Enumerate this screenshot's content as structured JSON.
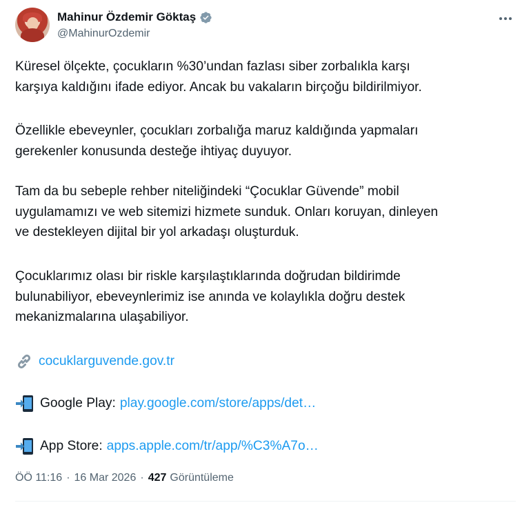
{
  "author": {
    "display_name": "Mahinur Özdemir Göktaş",
    "handle": "@MahinurOzdemir",
    "verified": true,
    "verified_color": "#829aab",
    "avatar": "avatar-photo"
  },
  "more_icon": "more-dots-icon",
  "tweet": {
    "paragraphs": [
      {
        "lines": [
          "Küresel ölçekte, çocukların %30’undan fazlası siber zorbalıkla karşı",
          "karşıya kaldığını ifade ediyor. Ancak bu vakaların birçoğu bildirilmiyor."
        ]
      },
      {
        "lines": [
          "Özellikle ebeveynler, çocukları zorbalığa maruz kaldığında yapmaları",
          "gerekenler konusunda desteğe ihtiyaç duyuyor."
        ]
      },
      {
        "lines": [
          "Tam da bu sebeple rehber niteliğindeki “Çocuklar Güvende” mobil",
          "uygulamamızı ve web sitemizi hizmete sunduk. Onları koruyan, dinleyen",
          "ve destekleyen dijital bir yol arkadaşı oluşturduk."
        ]
      },
      {
        "lines": [
          "Çocuklarımız olası bir riskle karşılaştıklarında doğrudan bildirimde",
          "bulunabiliyor, ebeveynlerimiz ise anında ve kolaylıkla doğru destek",
          "mekanizmalarına ulaşabiliyor."
        ]
      }
    ],
    "links": {
      "website": {
        "icon": "link-chain-icon",
        "url_text": "cocuklarguvende.gov.tr"
      },
      "google_play": {
        "icon": "mobile-arrow-icon",
        "label": "Google Play:",
        "url_text": "play.google.com/store/apps/det…"
      },
      "app_store": {
        "icon": "mobile-arrow-icon",
        "label": "App Store:",
        "url_text": "apps.apple.com/tr/app/%C3%A7o…"
      }
    },
    "link_color": "#1d9bf0"
  },
  "meta": {
    "time": "ÖÖ 11:16",
    "separator": "·",
    "date": "16 Mar 2026",
    "views_count": "427",
    "views_label": "Görüntüleme"
  },
  "colors": {
    "text": "#0f1419",
    "secondary": "#536471",
    "divider": "#eff3f4"
  }
}
